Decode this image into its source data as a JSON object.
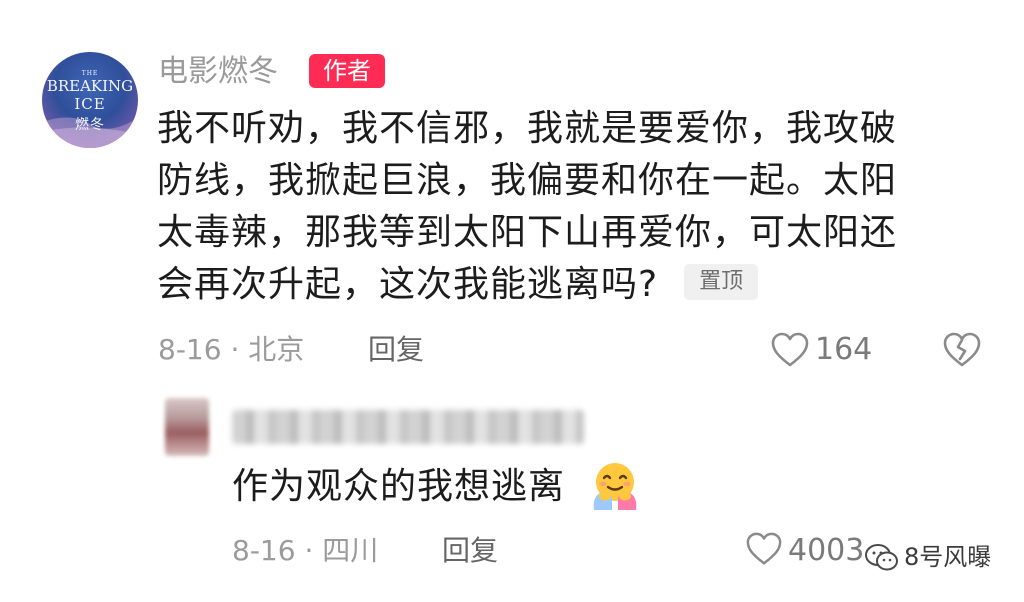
{
  "comment": {
    "avatar_text": [
      "THE",
      "BREAKING",
      "ICE",
      "燃冬"
    ],
    "username": "电影燃冬",
    "badge": "作者",
    "lines": [
      "我不听劝，我不信邪，我就是要爱你，我攻破",
      "防线，我掀起巨浪，我偏要和你在一起。太阳",
      "太毒辣，那我等到太阳下山再爱你，可太阳还",
      "会再次升起，这次我能逃离吗?"
    ],
    "pin_label": "置顶",
    "meta": "8-16 · 北京",
    "reply_label": "回复",
    "like_count": "164",
    "like_icon": "heart-outline-icon",
    "dislike_icon": "broken-heart-icon"
  },
  "reply": {
    "username_blurred": true,
    "text": "作为观众的我想逃离",
    "emoji": "hugging-face-emoji",
    "meta": "8-16 · 四川",
    "reply_label": "回复",
    "like_count": "4003",
    "like_icon": "heart-outline-icon"
  },
  "watermark": {
    "text": "8号风曝",
    "icon": "wechat-icon"
  },
  "colors": {
    "badge": "#fe2c55",
    "meta": "#9b9b9b",
    "text": "#1c1c1c"
  }
}
